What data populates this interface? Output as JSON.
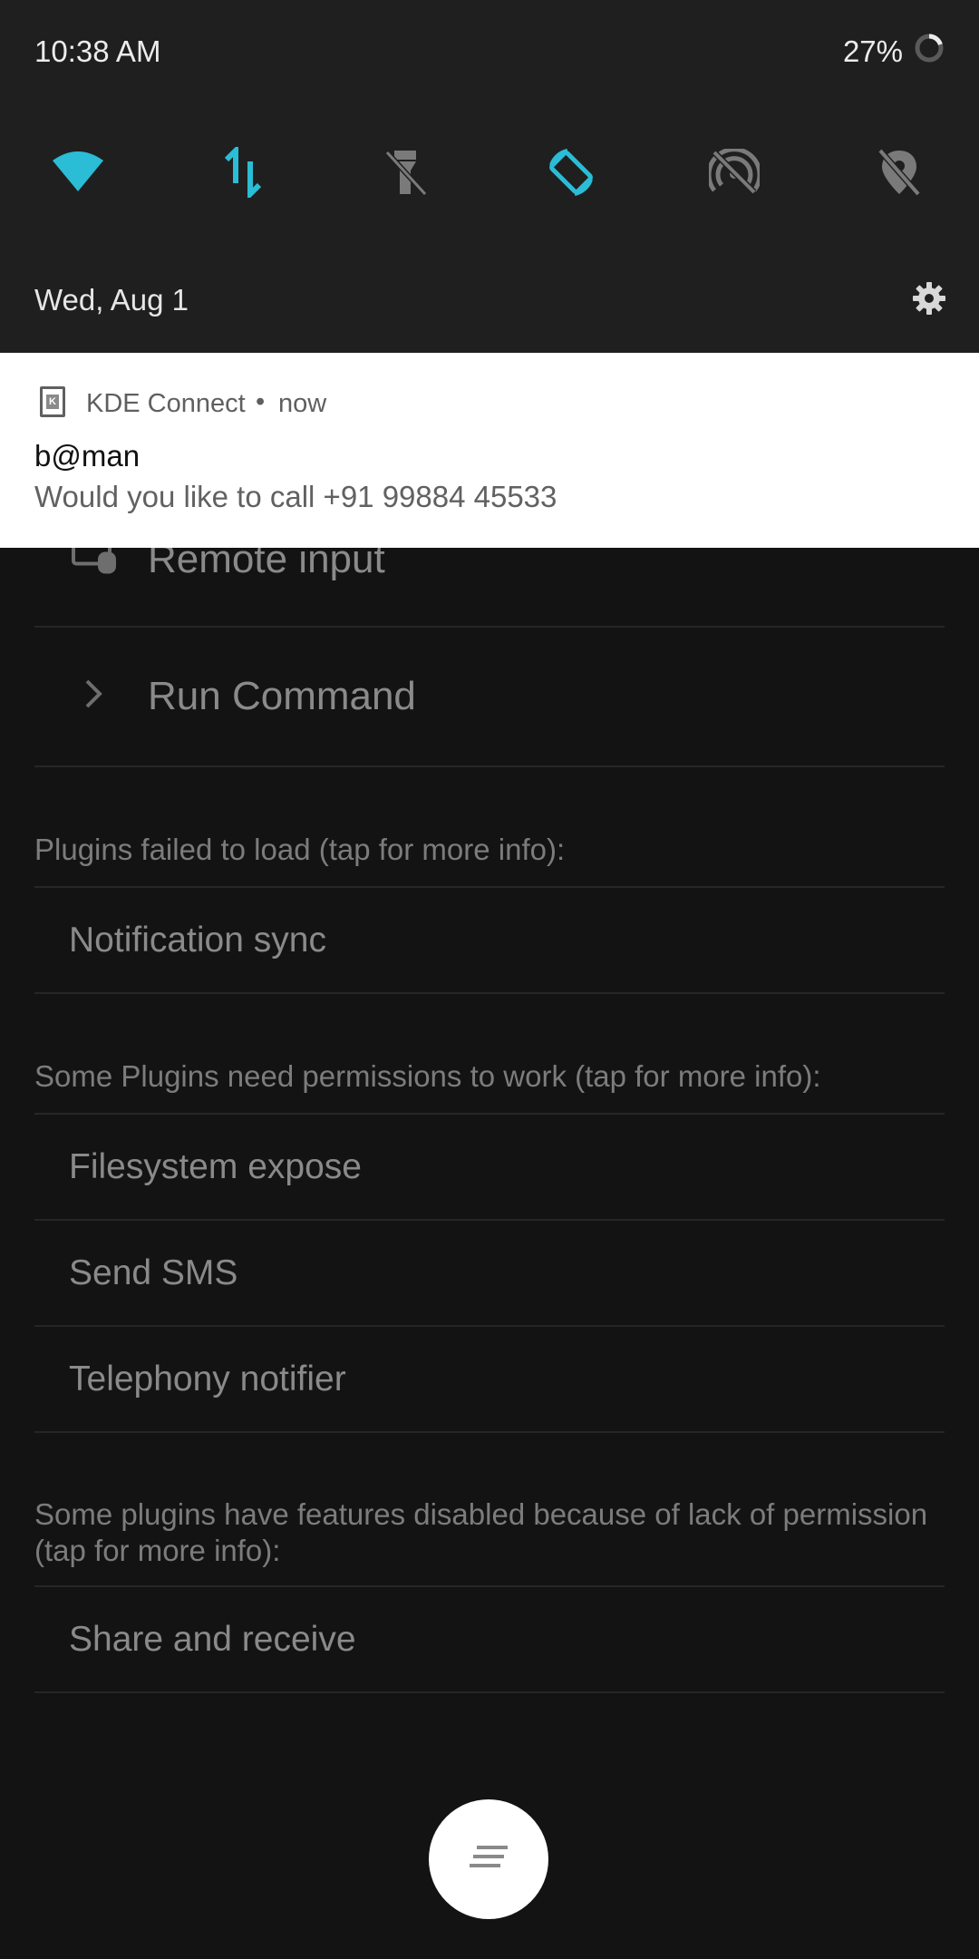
{
  "status_bar": {
    "time": "10:38 AM",
    "battery_percent": "27%"
  },
  "quick_settings": {
    "accent_color": "#2bbcd6",
    "inactive_color": "#7a7a7a",
    "tiles": [
      {
        "icon": "wifi-icon",
        "active": true
      },
      {
        "icon": "mobile-data-icon",
        "active": true
      },
      {
        "icon": "flashlight-off-icon",
        "active": false
      },
      {
        "icon": "auto-rotate-icon",
        "active": true
      },
      {
        "icon": "hotspot-off-icon",
        "active": false
      },
      {
        "icon": "location-off-icon",
        "active": false
      }
    ]
  },
  "shade": {
    "date": "Wed, Aug 1",
    "settings_icon": "gear-icon"
  },
  "notification": {
    "app_name": "KDE Connect",
    "separator": "•",
    "time": "now",
    "title": "b@man",
    "body": "Would you like to call +91 99884 45533"
  },
  "app": {
    "plugins": [
      {
        "label": "Remote input",
        "icon": "remote-input-icon"
      },
      {
        "label": "Run Command",
        "icon": "chevron-right-icon"
      }
    ],
    "failed_header": "Plugins failed to load (tap for more info):",
    "failed_items": [
      "Notification sync"
    ],
    "permissions_header": "Some Plugins need permissions to work (tap for more info):",
    "permissions_items": [
      "Filesystem expose",
      "Send SMS",
      "Telephony notifier"
    ],
    "disabled_header": "Some plugins have features disabled because of lack of permission (tap for more info):",
    "disabled_items": [
      "Share and receive"
    ],
    "fab_icon": "menu-lines-icon"
  }
}
